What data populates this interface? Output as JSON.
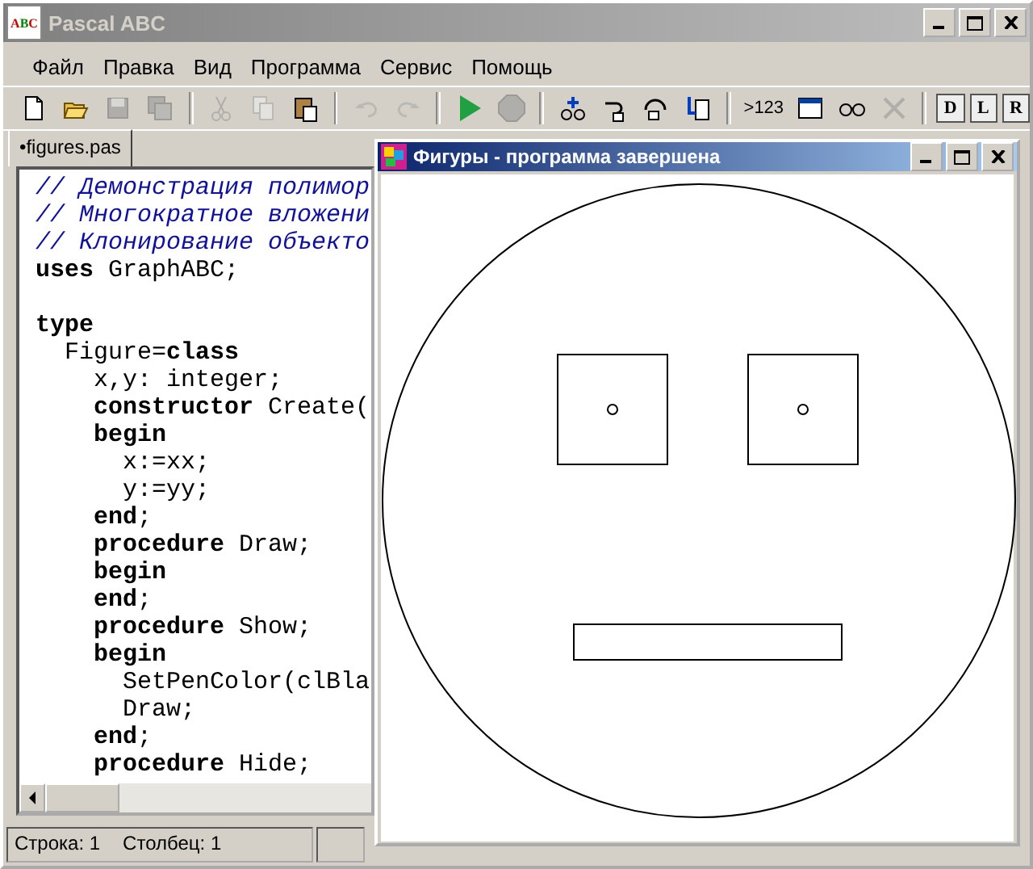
{
  "window": {
    "title": "Pascal ABC",
    "icon_letters": [
      "A",
      "B",
      "C"
    ]
  },
  "menu": [
    "Файл",
    "Правка",
    "Вид",
    "Программа",
    "Сервис",
    "Помощь"
  ],
  "toolbar": [
    {
      "disabled": false
    },
    {
      "disabled": false
    },
    {
      "disabled": true
    },
    {
      "disabled": true
    },
    {
      "kind": "sep"
    },
    {
      "disabled": true
    },
    {
      "disabled": true
    },
    {
      "disabled": false
    },
    {
      "kind": "sep"
    },
    {
      "disabled": true
    },
    {
      "disabled": true
    },
    {
      "kind": "sep"
    },
    {
      "disabled": false
    },
    {
      "disabled": true
    },
    {
      "kind": "sep"
    },
    {
      "disabled": false
    },
    {
      "disabled": false
    },
    {
      "disabled": false
    },
    {
      "disabled": false
    },
    {
      "kind": "sep"
    },
    {
      "disabled": false,
      "label": ">123"
    },
    {
      "disabled": false
    },
    {
      "disabled": false
    },
    {
      "disabled": true
    },
    {
      "kind": "sep"
    },
    {
      "disabled": false,
      "label": "D"
    },
    {
      "disabled": false,
      "label": "L"
    },
    {
      "disabled": false,
      "label": "R"
    }
  ],
  "tabs": [
    {
      "label": "•figures.pas",
      "selected": true
    }
  ],
  "code": [
    {
      "kind": "text",
      "segments": [
        {
          "kind": "comment",
          "text": "// Демонстрация полимор"
        }
      ]
    },
    {
      "kind": "text",
      "segments": [
        {
          "kind": "comment",
          "text": "// Многократное вложени"
        }
      ]
    },
    {
      "kind": "text",
      "segments": [
        {
          "kind": "comment",
          "text": "// Клонирование объекто"
        }
      ]
    },
    {
      "kind": "text",
      "segments": [
        {
          "kind": "keyword",
          "text": "uses"
        },
        {
          "kind": "plain",
          "text": " GraphABC;"
        }
      ]
    },
    {
      "kind": "blank"
    },
    {
      "kind": "text",
      "segments": [
        {
          "kind": "keyword",
          "text": "type"
        }
      ]
    },
    {
      "kind": "text",
      "segments": [
        {
          "kind": "plain",
          "text": "  Figure="
        },
        {
          "kind": "keyword",
          "text": "class"
        }
      ]
    },
    {
      "kind": "text",
      "segments": [
        {
          "kind": "plain",
          "text": "    x,y: integer;"
        }
      ]
    },
    {
      "kind": "text",
      "segments": [
        {
          "kind": "keyword",
          "text": "    constructor"
        },
        {
          "kind": "plain",
          "text": " Create("
        }
      ]
    },
    {
      "kind": "text",
      "segments": [
        {
          "kind": "keyword",
          "text": "    begin"
        }
      ]
    },
    {
      "kind": "text",
      "segments": [
        {
          "kind": "plain",
          "text": "      x:=xx;"
        }
      ]
    },
    {
      "kind": "text",
      "segments": [
        {
          "kind": "plain",
          "text": "      y:=yy;"
        }
      ]
    },
    {
      "kind": "text",
      "segments": [
        {
          "kind": "keyword",
          "text": "    end"
        },
        {
          "kind": "plain",
          "text": ";"
        }
      ]
    },
    {
      "kind": "text",
      "segments": [
        {
          "kind": "keyword",
          "text": "    procedure"
        },
        {
          "kind": "plain",
          "text": " Draw;"
        }
      ]
    },
    {
      "kind": "text",
      "segments": [
        {
          "kind": "keyword",
          "text": "    begin"
        }
      ]
    },
    {
      "kind": "text",
      "segments": [
        {
          "kind": "keyword",
          "text": "    end"
        },
        {
          "kind": "plain",
          "text": ";"
        }
      ]
    },
    {
      "kind": "text",
      "segments": [
        {
          "kind": "keyword",
          "text": "    procedure"
        },
        {
          "kind": "plain",
          "text": " Show;"
        }
      ]
    },
    {
      "kind": "text",
      "segments": [
        {
          "kind": "keyword",
          "text": "    begin"
        }
      ]
    },
    {
      "kind": "text",
      "segments": [
        {
          "kind": "plain",
          "text": "      SetPenColor(clBla"
        }
      ]
    },
    {
      "kind": "text",
      "segments": [
        {
          "kind": "plain",
          "text": "      Draw;"
        }
      ]
    },
    {
      "kind": "text",
      "segments": [
        {
          "kind": "keyword",
          "text": "    end"
        },
        {
          "kind": "plain",
          "text": ";"
        }
      ]
    },
    {
      "kind": "text",
      "segments": [
        {
          "kind": "keyword",
          "text": "    procedure"
        },
        {
          "kind": "plain",
          "text": " Hide;"
        }
      ]
    }
  ],
  "status_bar": [
    "Строка: 1",
    "Столбец: 1"
  ],
  "output_window": {
    "title": "Фигуры - программа завершена"
  }
}
